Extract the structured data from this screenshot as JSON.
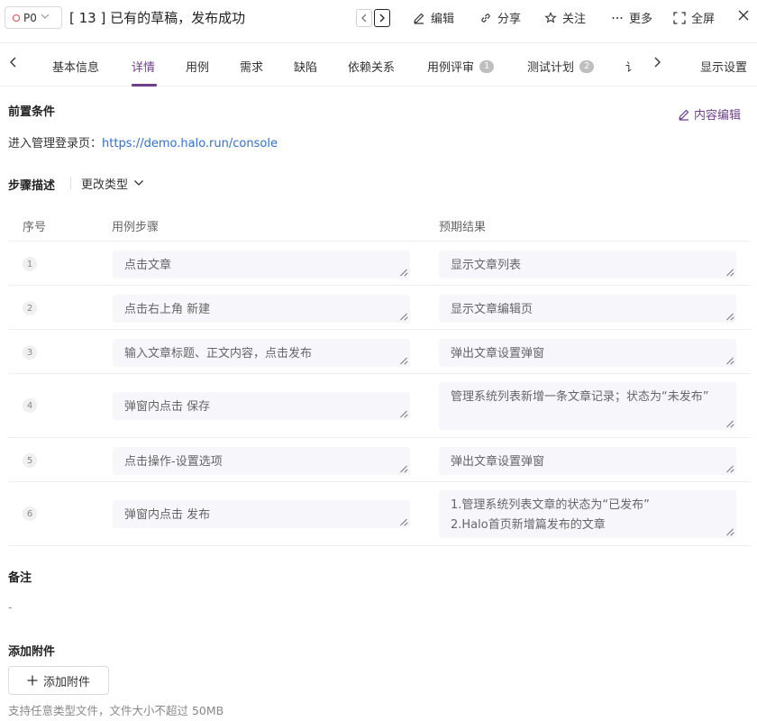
{
  "header": {
    "priority": "P0",
    "title": "[ 13 ] 已有的草稿，发布成功",
    "edit": "编辑",
    "share": "分享",
    "follow": "关注",
    "more": "更多",
    "fullscreen": "全屏"
  },
  "tabs": {
    "items": [
      {
        "label": "基本信息"
      },
      {
        "label": "详情"
      },
      {
        "label": "用例"
      },
      {
        "label": "需求"
      },
      {
        "label": "缺陷"
      },
      {
        "label": "依赖关系"
      },
      {
        "label": "用例评审",
        "badge": "1"
      },
      {
        "label": "测试计划",
        "badge": "2"
      },
      {
        "label": "讠"
      }
    ],
    "display_settings": "显示设置"
  },
  "precondition": {
    "title": "前置条件",
    "edit_label": "内容编辑",
    "text": "进入管理登录页：",
    "link": "https://demo.halo.run/console"
  },
  "steps": {
    "title": "步骤描述",
    "change_type": "更改类型",
    "columns": [
      "序号",
      "用例步骤",
      "预期结果"
    ],
    "rows": [
      {
        "num": "1",
        "step": "点击文章",
        "expected": "显示文章列表"
      },
      {
        "num": "2",
        "step": "点击右上角 新建",
        "expected": "显示文章编辑页"
      },
      {
        "num": "3",
        "step": "输入文章标题、正文内容，点击发布",
        "expected": "弹出文章设置弹窗"
      },
      {
        "num": "4",
        "step": "弹窗内点击 保存",
        "expected": "管理系统列表新增一条文章记录；状态为“未发布”"
      },
      {
        "num": "5",
        "step": "点击操作-设置选项",
        "expected": "弹出文章设置弹窗"
      },
      {
        "num": "6",
        "step": "弹窗内点击 发布",
        "expected": "1.管理系统列表文章的状态为“已发布”\n2.Halo首页新增篇发布的文章"
      }
    ]
  },
  "remarks": {
    "title": "备注",
    "value": "-"
  },
  "attachments": {
    "title": "添加附件",
    "button": "添加附件",
    "hint": "支持任意类型文件，文件大小不超过 50MB"
  },
  "colors": {
    "accent": "#6f3f8a",
    "link": "#2f6fd6",
    "priority_dot": "#e5484d"
  }
}
